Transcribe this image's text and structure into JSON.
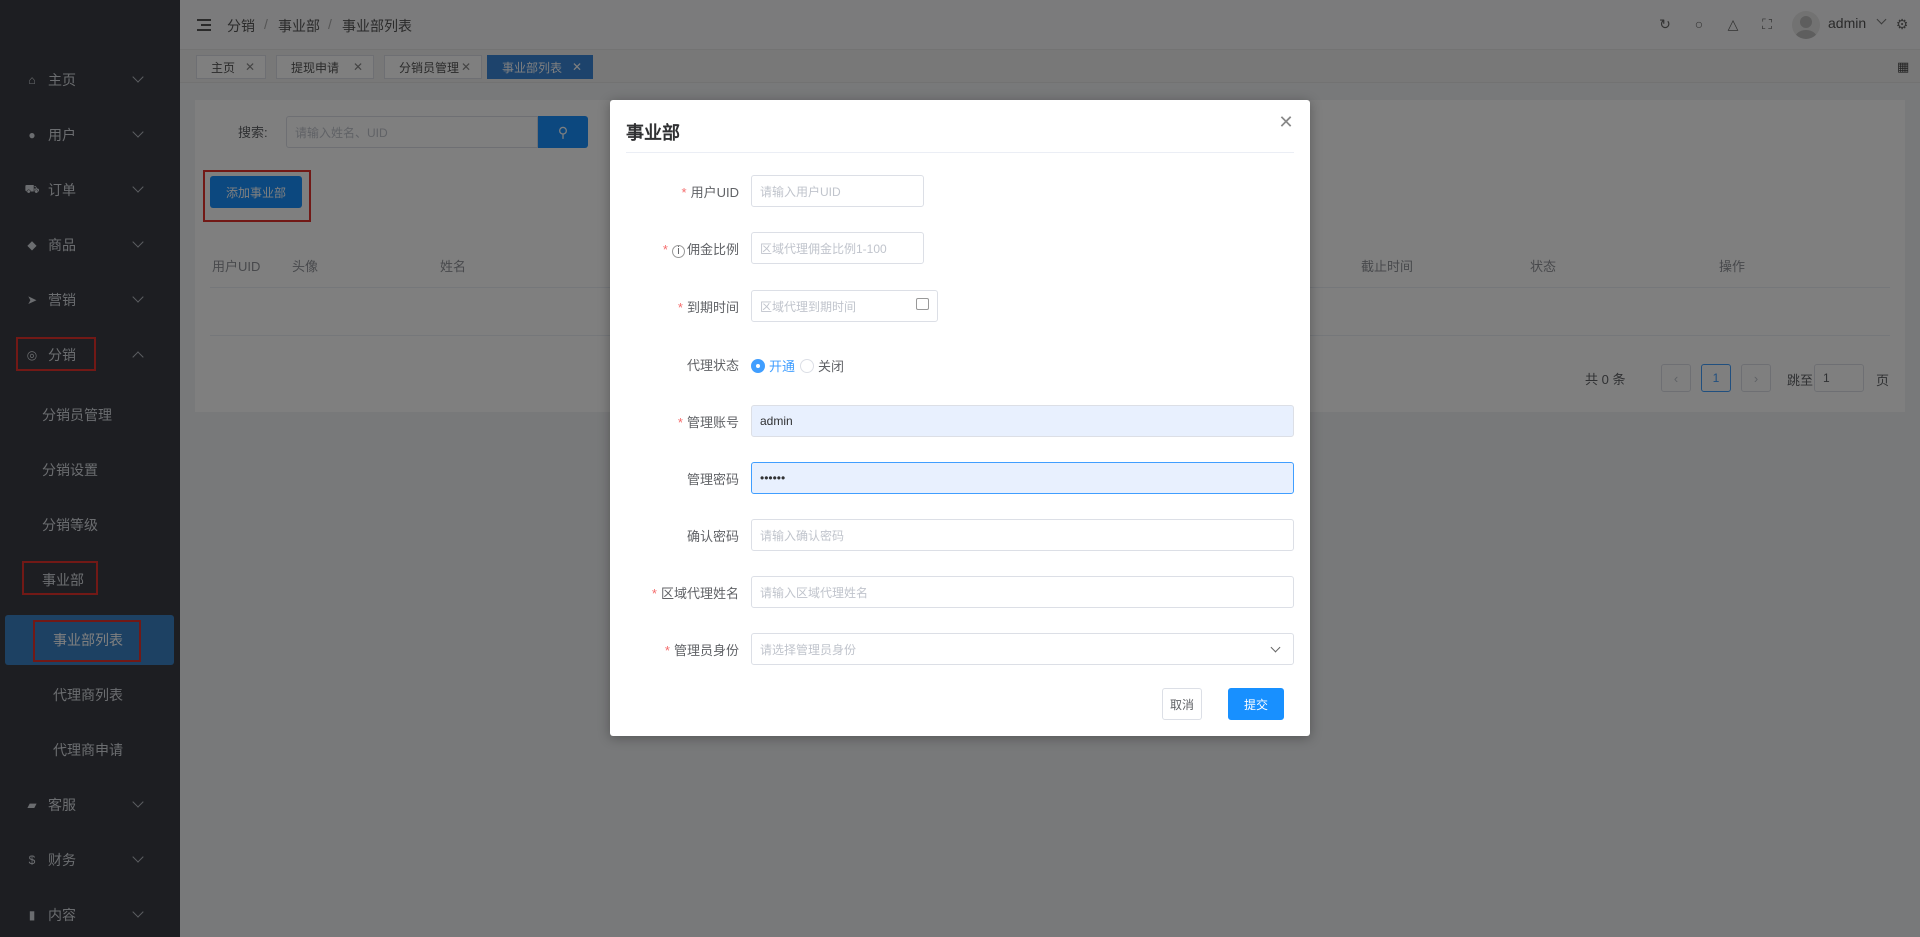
{
  "sidebar": {
    "menus": [
      {
        "label": "主页",
        "icon": "home-icon",
        "glyph": "⌂"
      },
      {
        "label": "用户",
        "icon": "user-icon",
        "glyph": "●"
      },
      {
        "label": "订单",
        "icon": "cart-icon",
        "glyph": "⛟"
      },
      {
        "label": "商品",
        "icon": "basket-icon",
        "glyph": "◆"
      },
      {
        "label": "营销",
        "icon": "send-icon",
        "glyph": "➤"
      },
      {
        "label": "分销",
        "icon": "handshake-icon",
        "glyph": "◎"
      }
    ],
    "distribution_items": [
      "分销员管理",
      "分销设置",
      "分销等级"
    ],
    "business_group": "事业部",
    "business_items": [
      "事业部列表",
      "代理商列表",
      "代理商申请"
    ],
    "bottom_menus": [
      {
        "label": "客服",
        "icon": "chat-icon",
        "glyph": "▰"
      },
      {
        "label": "财务",
        "icon": "dollar-icon",
        "glyph": "$"
      },
      {
        "label": "内容",
        "icon": "book-icon",
        "glyph": "▮"
      }
    ]
  },
  "header": {
    "breadcrumb": [
      "分销",
      "事业部",
      "事业部列表"
    ],
    "breadcrumb_sep": "/",
    "user": "admin"
  },
  "tabs": [
    "主页",
    "提现申请",
    "分销员管理",
    "事业部列表"
  ],
  "page": {
    "search_label": "搜索:",
    "search_placeholder": "请输入姓名、UID",
    "add_button": "添加事业部",
    "columns_left": [
      "用户UID",
      "头像",
      "姓名"
    ],
    "columns_right": [
      "截止时间",
      "状态",
      "操作"
    ],
    "pagination": {
      "total": "共 0 条",
      "current": "1",
      "jump_label": "跳至",
      "jump_value": "1",
      "page_suffix": "页"
    }
  },
  "dialog": {
    "title": "事业部",
    "fields": {
      "uid": {
        "label": "用户UID",
        "placeholder": "请输入用户UID"
      },
      "commission": {
        "label": "佣金比例",
        "placeholder": "区域代理佣金比例1-100"
      },
      "expire": {
        "label": "到期时间",
        "placeholder": "区域代理到期时间"
      },
      "status": {
        "label": "代理状态",
        "options": [
          "开通",
          "关闭"
        ],
        "selected": "开通"
      },
      "account": {
        "label": "管理账号",
        "value": "admin"
      },
      "password": {
        "label": "管理密码",
        "value": "••••••"
      },
      "confirm": {
        "label": "确认密码",
        "placeholder": "请输入确认密码"
      },
      "agent_name": {
        "label": "区域代理姓名",
        "placeholder": "请输入区域代理姓名"
      },
      "role": {
        "label": "管理员身份",
        "placeholder": "请选择管理员身份"
      }
    },
    "cancel": "取消",
    "submit": "提交"
  },
  "colors": {
    "accent": "#1890ff",
    "sidebar_bg": "#3a3d44",
    "highlight": "#e5322d",
    "active_menu": "#3b82c7"
  }
}
